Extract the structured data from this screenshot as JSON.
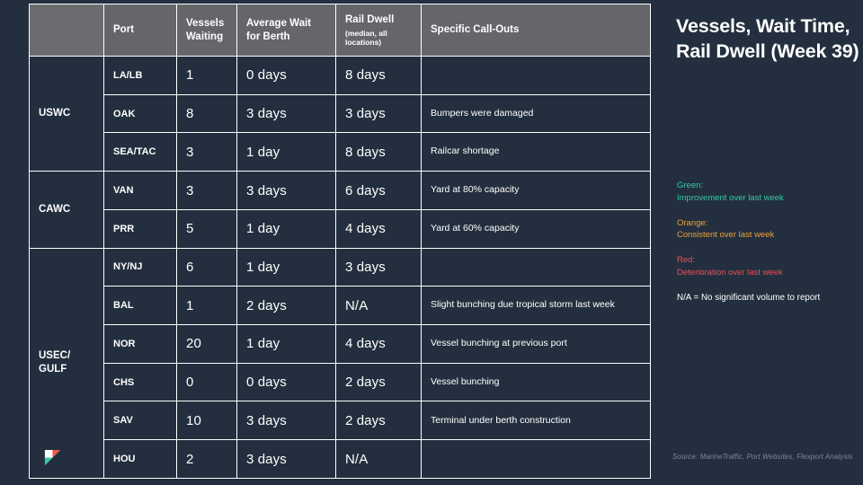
{
  "panel": {
    "title": "Vessels, Wait Time, Rail Dwell (Week 39)",
    "legend": [
      {
        "key": "Green:",
        "desc": "Improvement over last week",
        "color": "#35c9a6"
      },
      {
        "key": "Orange:",
        "desc": "Consistent over last week",
        "color": "#e9a33c"
      },
      {
        "key": "Red:",
        "desc": "Deterioration over last week",
        "color": "#e9505c"
      }
    ],
    "note": "N/A = No significant volume to report",
    "source": "Source: MarineTraffic, Port Websites, Flexport Analysis",
    "logo_name": "flexport-logo"
  },
  "table": {
    "columns": [
      {
        "label": "",
        "sub": ""
      },
      {
        "label": "Port",
        "sub": ""
      },
      {
        "label": "Vessels Waiting",
        "sub": ""
      },
      {
        "label": "Average Wait for Berth",
        "sub": ""
      },
      {
        "label": "Rail Dwell",
        "sub": "(median, all locations)"
      },
      {
        "label": "Specific Call-Outs",
        "sub": ""
      }
    ],
    "groups": [
      {
        "name": "USWC",
        "rows": [
          {
            "port": "LA/LB",
            "vessels": "1",
            "vessels_color": "green",
            "wait": "0 days",
            "wait_color": "orange",
            "rail": "8 days",
            "rail_color": "orange",
            "callout": ""
          },
          {
            "port": "OAK",
            "vessels": "8",
            "vessels_color": "green",
            "wait": "3 days",
            "wait_color": "red",
            "rail": "3 days",
            "rail_color": "orange",
            "callout": "Bumpers were damaged"
          },
          {
            "port": "SEA/TAC",
            "vessels": "3",
            "vessels_color": "orange",
            "wait": "1 day",
            "wait_color": "orange",
            "rail": "8 days",
            "rail_color": "orange",
            "callout": "Railcar shortage"
          }
        ]
      },
      {
        "name": "CAWC",
        "rows": [
          {
            "port": "VAN",
            "vessels": "3",
            "vessels_color": "red",
            "wait": "3 days",
            "wait_color": "orange",
            "rail": "6 days",
            "rail_color": "green",
            "callout": "Yard at 80% capacity"
          },
          {
            "port": "PRR",
            "vessels": "5",
            "vessels_color": "red",
            "wait": "1 day",
            "wait_color": "orange",
            "rail": "4 days",
            "rail_color": "orange",
            "callout": "Yard at 60% capacity"
          }
        ]
      },
      {
        "name": "USEC/ GULF",
        "rows": [
          {
            "port": "NY/NJ",
            "vessels": "6",
            "vessels_color": "red",
            "wait": "1 day",
            "wait_color": "orange",
            "rail": "3 days",
            "rail_color": "orange",
            "callout": ""
          },
          {
            "port": "BAL",
            "vessels": "1",
            "vessels_color": "red",
            "wait": "2 days",
            "wait_color": "red",
            "rail": "N/A",
            "rail_color": "white",
            "callout": "Slight bunching due tropical storm last week"
          },
          {
            "port": "NOR",
            "vessels": "20",
            "vessels_color": "red",
            "wait": "1 day",
            "wait_color": "orange",
            "rail": "4 days",
            "rail_color": "orange",
            "callout": "Vessel bunching at previous port"
          },
          {
            "port": "CHS",
            "vessels": "0",
            "vessels_color": "orange",
            "wait": "0 days",
            "wait_color": "orange",
            "rail": "2 days",
            "rail_color": "orange",
            "callout": "Vessel bunching"
          },
          {
            "port": "SAV",
            "vessels": "10",
            "vessels_color": "green",
            "wait": "3 days",
            "wait_color": "green",
            "rail": "2 days",
            "rail_color": "orange",
            "callout": "Terminal under berth construction"
          },
          {
            "port": "HOU",
            "vessels": "2",
            "vessels_color": "green",
            "wait": "3 days",
            "wait_color": "green",
            "rail": "N/A",
            "rail_color": "white",
            "callout": ""
          }
        ]
      }
    ]
  },
  "colors": {
    "background": "#232f3e",
    "header_grey": "#64666a",
    "border": "#ffffff",
    "green": "#35c9a6",
    "orange": "#e9a33c",
    "red": "#e9505c"
  }
}
